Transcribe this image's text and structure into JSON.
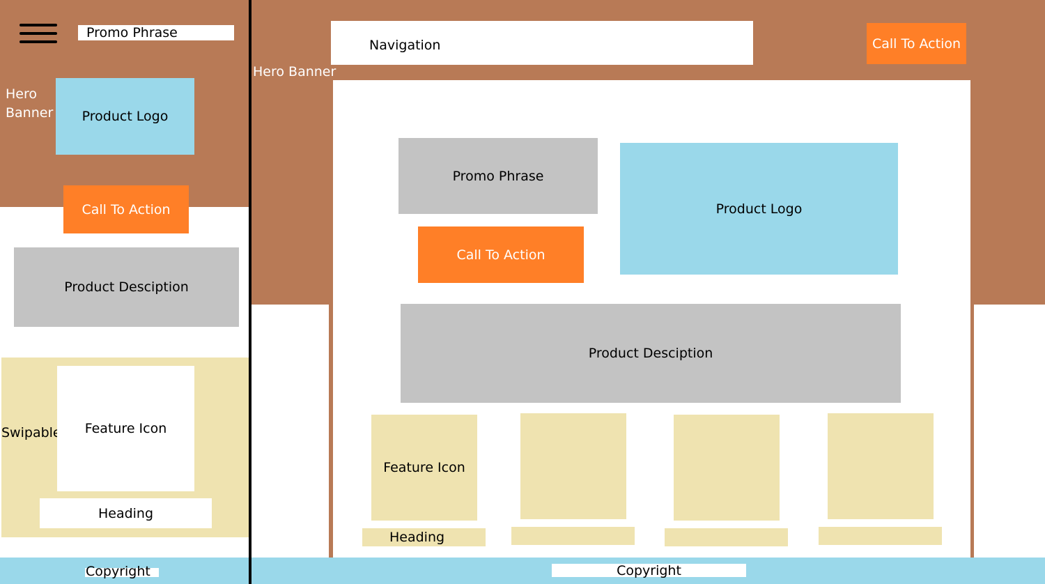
{
  "mobile": {
    "promo_phrase": "Promo Phrase",
    "hero_banner": "Hero\nBanner",
    "product_logo": "Product Logo",
    "call_to_action": "Call To Action",
    "product_description": "Product Desciption",
    "swipable": "Swipable",
    "feature_icon": "Feature Icon",
    "heading": "Heading",
    "copyright": "Copyright"
  },
  "desktop": {
    "navigation": "Navigation",
    "header_call_to_action": "Call To Action",
    "hero_banner": "Hero Banner",
    "promo_phrase": "Promo Phrase",
    "product_logo": "Product Logo",
    "call_to_action": "Call To Action",
    "product_description": "Product Desciption",
    "features": [
      {
        "icon_label": "Feature Icon",
        "heading": "Heading"
      },
      {
        "icon_label": "",
        "heading": ""
      },
      {
        "icon_label": "",
        "heading": ""
      },
      {
        "icon_label": "",
        "heading": ""
      }
    ],
    "copyright": "Copyright"
  },
  "colors": {
    "hero_brown": "#b87a56",
    "logo_blue": "#9ad8ea",
    "cta_orange": "#ff7f27",
    "description_gray": "#c3c3c3",
    "feature_tan": "#efe3b0",
    "footer_blue": "#9ad8ea"
  }
}
